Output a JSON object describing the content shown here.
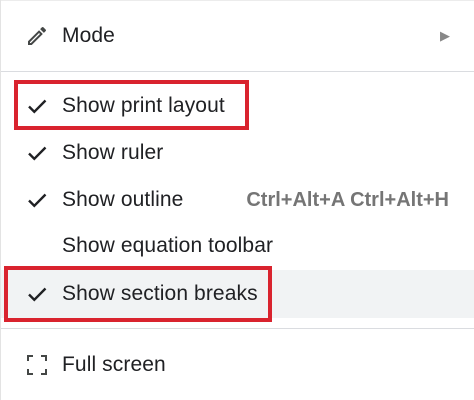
{
  "menu": {
    "mode": {
      "label": "Mode",
      "icon": "pencil-icon",
      "arrow": "▶"
    },
    "print_layout": {
      "label": "Show print layout",
      "checked": true
    },
    "ruler": {
      "label": "Show ruler",
      "checked": true
    },
    "outline": {
      "label": "Show outline",
      "checked": true,
      "shortcut": "Ctrl+Alt+A Ctrl+Alt+H"
    },
    "equation_toolbar": {
      "label": "Show equation toolbar",
      "checked": false
    },
    "section_breaks": {
      "label": "Show section breaks",
      "checked": true
    },
    "full_screen": {
      "label": "Full screen",
      "icon": "fullscreen-icon"
    }
  },
  "colors": {
    "highlight": "#d9232e",
    "hover": "#f1f3f4",
    "text": "#202124",
    "shortcut": "#757575",
    "divider": "#dadce0"
  }
}
